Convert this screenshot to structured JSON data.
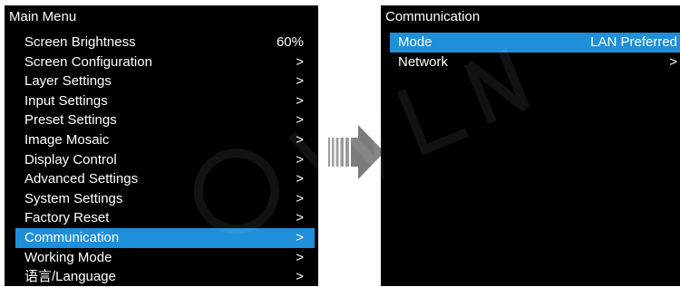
{
  "main_menu": {
    "title": "Main Menu",
    "items": [
      {
        "label": "Screen Brightness",
        "value": "60%"
      },
      {
        "label": "Screen Configuration",
        "value": ">"
      },
      {
        "label": "Layer Settings",
        "value": ">"
      },
      {
        "label": "Input Settings",
        "value": ">"
      },
      {
        "label": "Preset Settings",
        "value": ">"
      },
      {
        "label": "Image Mosaic",
        "value": ">"
      },
      {
        "label": "Display Control",
        "value": ">"
      },
      {
        "label": "Advanced Settings",
        "value": ">"
      },
      {
        "label": "System Settings",
        "value": ">"
      },
      {
        "label": "Factory Reset",
        "value": ">"
      },
      {
        "label": "Communication",
        "value": ">"
      },
      {
        "label": "Working Mode",
        "value": ">"
      },
      {
        "label": "语言/Language",
        "value": ">"
      }
    ],
    "selected_item": "Communication"
  },
  "communication_menu": {
    "title": "Communication",
    "items": [
      {
        "label": "Mode",
        "value": "LAN Preferred"
      },
      {
        "label": "Network",
        "value": ">"
      }
    ],
    "selected_item": "Mode"
  },
  "colors": {
    "panel_background": "#000000",
    "text": "#ffffff",
    "selection_highlight": "#1f8fd9",
    "arrow": "#808080"
  },
  "icons": {
    "transition_arrow": "right-arrow-icon",
    "watermark": "watermark-logo"
  }
}
